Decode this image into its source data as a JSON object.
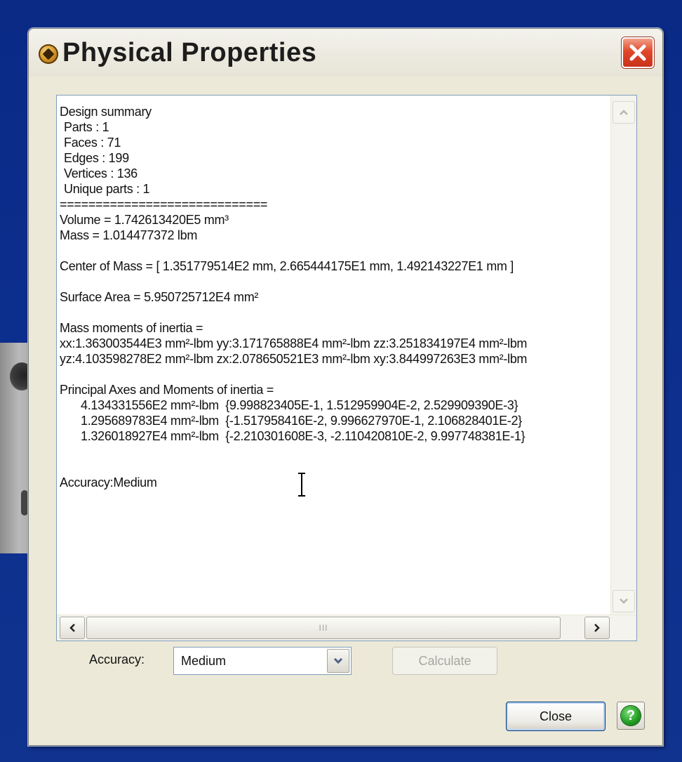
{
  "window": {
    "title": "Physical Properties",
    "close_icon": "close-x-icon",
    "app_icon": "solid-edge-app-icon"
  },
  "report": {
    "lines": [
      {
        "text": "Design summary",
        "style": "normal"
      },
      {
        "text": "Parts : 1",
        "style": "indent"
      },
      {
        "text": "Faces : 71",
        "style": "indent"
      },
      {
        "text": "Edges : 199",
        "style": "indent"
      },
      {
        "text": "Vertices : 136",
        "style": "indent"
      },
      {
        "text": "Unique parts : 1",
        "style": "indent"
      },
      {
        "text": "=============================",
        "style": "normal"
      },
      {
        "text": "Volume = 1.742613420E5 mm³",
        "style": "normal"
      },
      {
        "text": "Mass = 1.014477372 lbm",
        "style": "normal"
      },
      {
        "text": "",
        "style": "blank"
      },
      {
        "text": "Center of Mass = [ 1.351779514E2 mm, 2.665444175E1 mm, 1.492143227E1 mm ]",
        "style": "normal"
      },
      {
        "text": "",
        "style": "blank"
      },
      {
        "text": "Surface Area = 5.950725712E4 mm²",
        "style": "normal"
      },
      {
        "text": "",
        "style": "blank"
      },
      {
        "text": "Mass moments of inertia =",
        "style": "normal"
      },
      {
        "text": "xx:1.363003544E3 mm²-lbm yy:3.171765888E4 mm²-lbm zz:3.251834197E4 mm²-lbm",
        "style": "normal"
      },
      {
        "text": "yz:4.103598278E2 mm²-lbm zx:2.078650521E3 mm²-lbm xy:3.844997263E3 mm²-lbm",
        "style": "normal"
      },
      {
        "text": "",
        "style": "blank"
      },
      {
        "text": "Principal Axes and Moments of inertia =",
        "style": "normal"
      },
      {
        "text": "4.134331556E2 mm²-lbm  {9.998823405E-1, 1.512959904E-2, 2.529909390E-3}",
        "style": "deep"
      },
      {
        "text": "1.295689783E4 mm²-lbm  {-1.517958416E-2, 9.996627970E-1, 2.106828401E-2}",
        "style": "deep"
      },
      {
        "text": "1.326018927E4 mm²-lbm  {-2.210301608E-3, -2.110420810E-2, 9.997748381E-1}",
        "style": "deep"
      },
      {
        "text": "",
        "style": "blank"
      },
      {
        "text": "",
        "style": "blank"
      },
      {
        "text": "Accuracy:Medium",
        "style": "normal"
      }
    ]
  },
  "scrollbars": {
    "vertical_up_icon": "chevron-up-icon",
    "vertical_down_icon": "chevron-down-icon",
    "horizontal_left_icon": "chevron-left-icon",
    "horizontal_right_icon": "chevron-right-icon",
    "thumb_grip": "III"
  },
  "controls": {
    "accuracy_label": "Accuracy:",
    "accuracy_value": "Medium",
    "calculate_label": "Calculate",
    "close_label": "Close",
    "help_label": "?"
  },
  "colors": {
    "desktop": "#0a2a86",
    "dialog_face": "#ece9d8",
    "close_red": "#e1482a",
    "help_green": "#1f9a1f"
  }
}
